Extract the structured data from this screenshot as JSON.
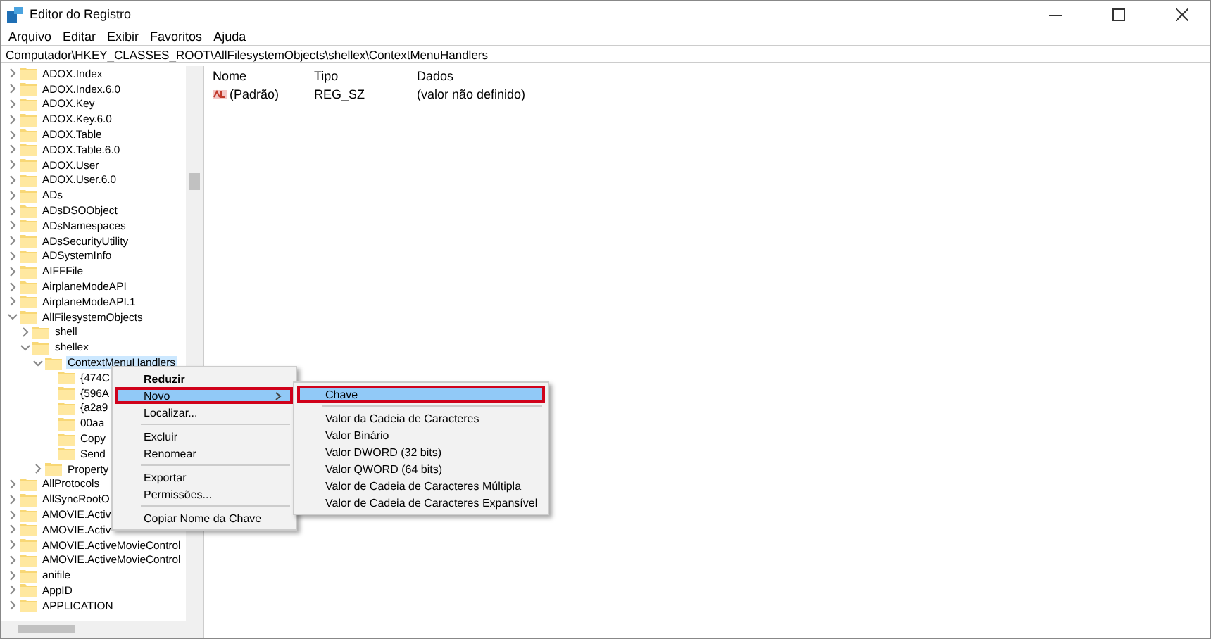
{
  "window": {
    "title": "Editor do Registro"
  },
  "menu": [
    "Arquivo",
    "Editar",
    "Exibir",
    "Favoritos",
    "Ajuda"
  ],
  "address": "Computador\\HKEY_CLASSES_ROOT\\AllFilesystemObjects\\shellex\\ContextMenuHandlers",
  "tree": [
    {
      "label": "ADOX.Index",
      "expandable": true,
      "expanded": false,
      "selected": false
    },
    {
      "label": "ADOX.Index.6.0",
      "expandable": true,
      "expanded": false,
      "selected": false
    },
    {
      "label": "ADOX.Key",
      "expandable": true,
      "expanded": false,
      "selected": false
    },
    {
      "label": "ADOX.Key.6.0",
      "expandable": true,
      "expanded": false,
      "selected": false
    },
    {
      "label": "ADOX.Table",
      "expandable": true,
      "expanded": false,
      "selected": false
    },
    {
      "label": "ADOX.Table.6.0",
      "expandable": true,
      "expanded": false,
      "selected": false
    },
    {
      "label": "ADOX.User",
      "expandable": true,
      "expanded": false,
      "selected": false
    },
    {
      "label": "ADOX.User.6.0",
      "expandable": true,
      "expanded": false,
      "selected": false
    },
    {
      "label": "ADs",
      "expandable": true,
      "expanded": false,
      "selected": false
    },
    {
      "label": "ADsDSOObject",
      "expandable": true,
      "expanded": false,
      "selected": false
    },
    {
      "label": "ADsNamespaces",
      "expandable": true,
      "expanded": false,
      "selected": false
    },
    {
      "label": "ADsSecurityUtility",
      "expandable": true,
      "expanded": false,
      "selected": false
    },
    {
      "label": "ADSystemInfo",
      "expandable": true,
      "expanded": false,
      "selected": false
    },
    {
      "label": "AIFFFile",
      "expandable": true,
      "expanded": false,
      "selected": false
    },
    {
      "label": "AirplaneModeAPI",
      "expandable": true,
      "expanded": false,
      "selected": false
    },
    {
      "label": "AirplaneModeAPI.1",
      "expandable": true,
      "expanded": false,
      "selected": false
    },
    {
      "label": "AllFilesystemObjects",
      "expandable": true,
      "expanded": true,
      "selected": false,
      "children": [
        {
          "label": "shell",
          "expandable": true,
          "expanded": false,
          "selected": false
        },
        {
          "label": "shellex",
          "expandable": true,
          "expanded": true,
          "selected": false,
          "children": [
            {
              "label": "ContextMenuHandlers",
              "expandable": true,
              "expanded": true,
              "selected": true,
              "children": [
                {
                  "label": "{474C",
                  "expandable": false,
                  "selected": false
                },
                {
                  "label": "{596A",
                  "expandable": false,
                  "selected": false
                },
                {
                  "label": "{a2a9",
                  "expandable": false,
                  "selected": false
                },
                {
                  "label": "00aa",
                  "expandable": false,
                  "selected": false
                },
                {
                  "label": "Copy",
                  "expandable": false,
                  "selected": false
                },
                {
                  "label": "Send",
                  "expandable": false,
                  "selected": false
                }
              ]
            },
            {
              "label": "Property",
              "expandable": true,
              "expanded": false,
              "selected": false
            }
          ]
        }
      ]
    },
    {
      "label": "AllProtocols",
      "expandable": true,
      "expanded": false,
      "selected": false
    },
    {
      "label": "AllSyncRootO",
      "expandable": true,
      "expanded": false,
      "selected": false
    },
    {
      "label": "AMOVIE.Activ",
      "expandable": true,
      "expanded": false,
      "selected": false
    },
    {
      "label": "AMOVIE.Activ",
      "expandable": true,
      "expanded": false,
      "selected": false
    },
    {
      "label": "AMOVIE.ActiveMovieControl",
      "expandable": true,
      "expanded": false,
      "selected": false
    },
    {
      "label": "AMOVIE.ActiveMovieControl",
      "expandable": true,
      "expanded": false,
      "selected": false
    },
    {
      "label": "anifile",
      "expandable": true,
      "expanded": false,
      "selected": false
    },
    {
      "label": "AppID",
      "expandable": true,
      "expanded": false,
      "selected": false
    },
    {
      "label": "APPLICATION",
      "expandable": true,
      "expanded": false,
      "selected": false
    }
  ],
  "table": {
    "columns": [
      "Nome",
      "Tipo",
      "Dados"
    ],
    "rows": [
      {
        "name": "(Padrão)",
        "type": "REG_SZ",
        "data": "(valor não definido)"
      }
    ]
  },
  "context_menu": [
    {
      "kind": "item",
      "label": "Reduzir",
      "bold": true,
      "selected": false,
      "submenu": false
    },
    {
      "kind": "item",
      "label": "Novo",
      "bold": false,
      "selected": true,
      "submenu": true
    },
    {
      "kind": "item",
      "label": "Localizar...",
      "bold": false,
      "selected": false,
      "submenu": false
    },
    {
      "kind": "separator"
    },
    {
      "kind": "item",
      "label": "Excluir",
      "bold": false,
      "selected": false,
      "submenu": false
    },
    {
      "kind": "item",
      "label": "Renomear",
      "bold": false,
      "selected": false,
      "submenu": false
    },
    {
      "kind": "separator"
    },
    {
      "kind": "item",
      "label": "Exportar",
      "bold": false,
      "selected": false,
      "submenu": false
    },
    {
      "kind": "item",
      "label": "Permissões...",
      "bold": false,
      "selected": false,
      "submenu": false
    },
    {
      "kind": "separator"
    },
    {
      "kind": "item",
      "label": "Copiar Nome da Chave",
      "bold": false,
      "selected": false,
      "submenu": false
    }
  ],
  "submenu": [
    {
      "kind": "item",
      "label": "Chave",
      "selected": true
    },
    {
      "kind": "separator"
    },
    {
      "kind": "item",
      "label": "Valor da Cadeia de Caracteres",
      "selected": false
    },
    {
      "kind": "item",
      "label": "Valor Binário",
      "selected": false
    },
    {
      "kind": "item",
      "label": "Valor DWORD (32 bits)",
      "selected": false
    },
    {
      "kind": "item",
      "label": "Valor QWORD (64 bits)",
      "selected": false
    },
    {
      "kind": "item",
      "label": "Valor de Cadeia de Caracteres Múltipla",
      "selected": false
    },
    {
      "kind": "item",
      "label": "Valor de Cadeia de Caracteres Expansível",
      "selected": false
    }
  ]
}
